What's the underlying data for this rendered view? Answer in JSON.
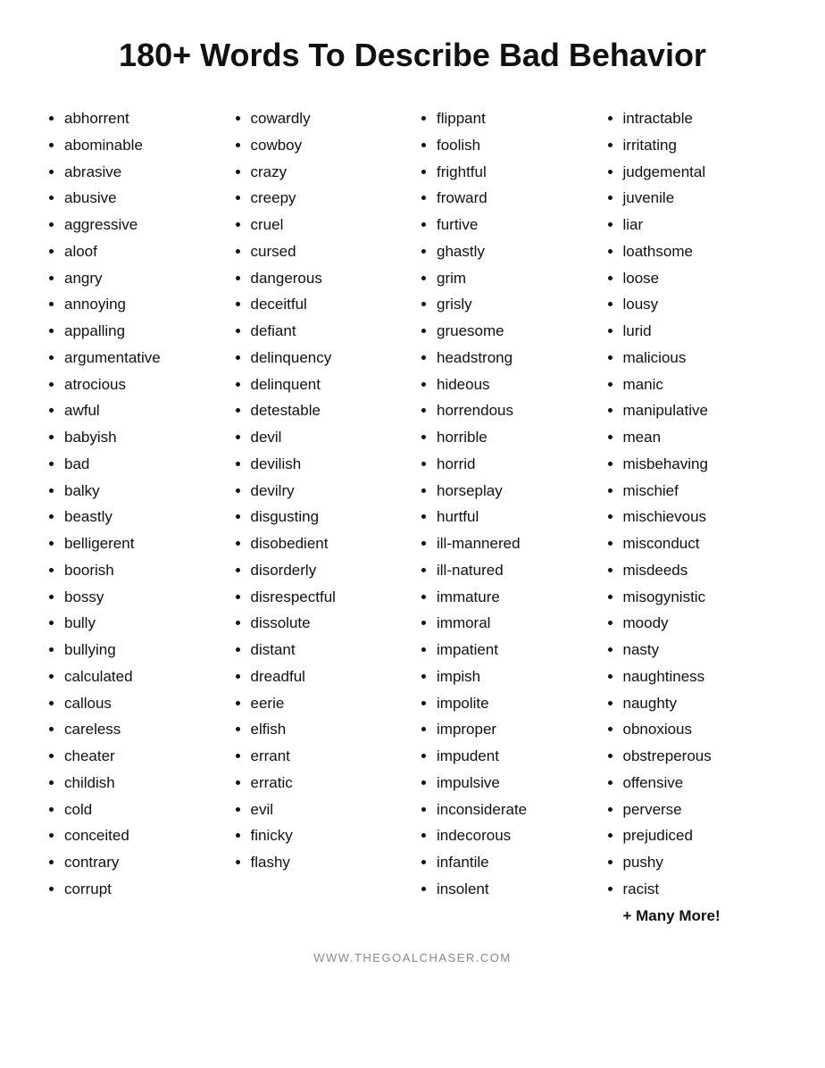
{
  "title": "180+ Words To Describe Bad Behavior",
  "columns": [
    {
      "id": "col1",
      "words": [
        "abhorrent",
        "abominable",
        "abrasive",
        "abusive",
        "aggressive",
        "aloof",
        "angry",
        "annoying",
        "appalling",
        "argumentative",
        "atrocious",
        "awful",
        "babyish",
        "bad",
        "balky",
        "beastly",
        "belligerent",
        "boorish",
        "bossy",
        "bully",
        "bullying",
        "calculated",
        "callous",
        "careless",
        "cheater",
        "childish",
        "cold",
        "conceited",
        "contrary",
        "corrupt"
      ]
    },
    {
      "id": "col2",
      "words": [
        "cowardly",
        "cowboy",
        "crazy",
        "creepy",
        "cruel",
        "cursed",
        "dangerous",
        "deceitful",
        "defiant",
        "delinquency",
        "delinquent",
        "detestable",
        "devil",
        "devilish",
        "devilry",
        "disgusting",
        "disobedient",
        "disorderly",
        "disrespectful",
        "dissolute",
        "distant",
        "dreadful",
        "eerie",
        "elfish",
        "errant",
        "erratic",
        "evil",
        "finicky",
        "flashy"
      ]
    },
    {
      "id": "col3",
      "words": [
        "flippant",
        "foolish",
        "frightful",
        "froward",
        "furtive",
        "ghastly",
        "grim",
        "grisly",
        "gruesome",
        "headstrong",
        "hideous",
        "horrendous",
        "horrible",
        "horrid",
        "horseplay",
        "hurtful",
        "ill-mannered",
        "ill-natured",
        "immature",
        "immoral",
        "impatient",
        "impish",
        "impolite",
        "improper",
        "impudent",
        "impulsive",
        "inconsiderate",
        "indecorous",
        "infantile",
        "insolent"
      ]
    },
    {
      "id": "col4",
      "words": [
        "intractable",
        "irritating",
        "judgemental",
        "juvenile",
        "liar",
        "loathsome",
        "loose",
        "lousy",
        "lurid",
        "malicious",
        "manic",
        "manipulative",
        "mean",
        "misbehaving",
        "mischief",
        "mischievous",
        "misconduct",
        "misdeeds",
        "misogynistic",
        "moody",
        "nasty",
        "naughtiness",
        "naughty",
        "obnoxious",
        "obstreperous",
        "offensive",
        "perverse",
        "prejudiced",
        "pushy",
        "racist"
      ]
    }
  ],
  "extra": "+ Many More!",
  "footer": "WWW.THEGOALCHASER.COM"
}
